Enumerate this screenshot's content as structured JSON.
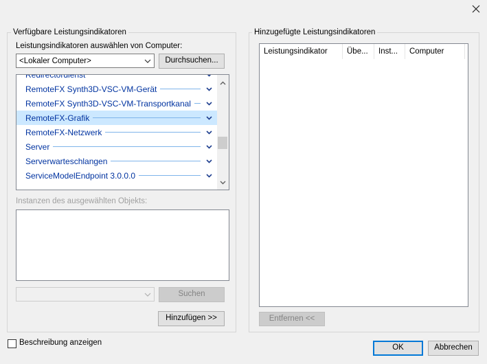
{
  "window": {
    "close_label": "×"
  },
  "left_group": {
    "title": "Verfügbare Leistungsindikatoren",
    "select_from_label": "Leistungsindikatoren auswählen von Computer:",
    "computer_combo_value": "<Lokaler Computer>",
    "browse_button": "Durchsuchen...",
    "objects": [
      {
        "label": "Redirectordienst",
        "selected": false
      },
      {
        "label": "RemoteFX Synth3D-VSC-VM-Gerät",
        "selected": false
      },
      {
        "label": "RemoteFX Synth3D-VSC-VM-Transportkanal",
        "selected": false
      },
      {
        "label": "RemoteFX-Grafik",
        "selected": true
      },
      {
        "label": "RemoteFX-Netzwerk",
        "selected": false
      },
      {
        "label": "Server",
        "selected": false
      },
      {
        "label": "Serverwarteschlangen",
        "selected": false
      },
      {
        "label": "ServiceModelEndpoint 3.0.0.0",
        "selected": false
      }
    ],
    "instances_label": "Instanzen des ausgewählten Objekts:",
    "search_button": "Suchen",
    "add_button": "Hinzufügen >>"
  },
  "right_group": {
    "title": "Hinzugefügte Leistungsindikatoren",
    "columns": [
      "Leistungsindikator",
      "Übe...",
      "Inst...",
      "Computer"
    ],
    "remove_button": "Entfernen <<"
  },
  "footer": {
    "show_description_label": "Beschreibung anzeigen",
    "show_description_checked": false,
    "ok_button": "OK",
    "cancel_button": "Abbrechen"
  },
  "colors": {
    "dialog_bg": "#f0f0f0",
    "object_text": "#0033a0",
    "selection_bg": "#cce8ff",
    "default_button_border": "#0078d7"
  }
}
